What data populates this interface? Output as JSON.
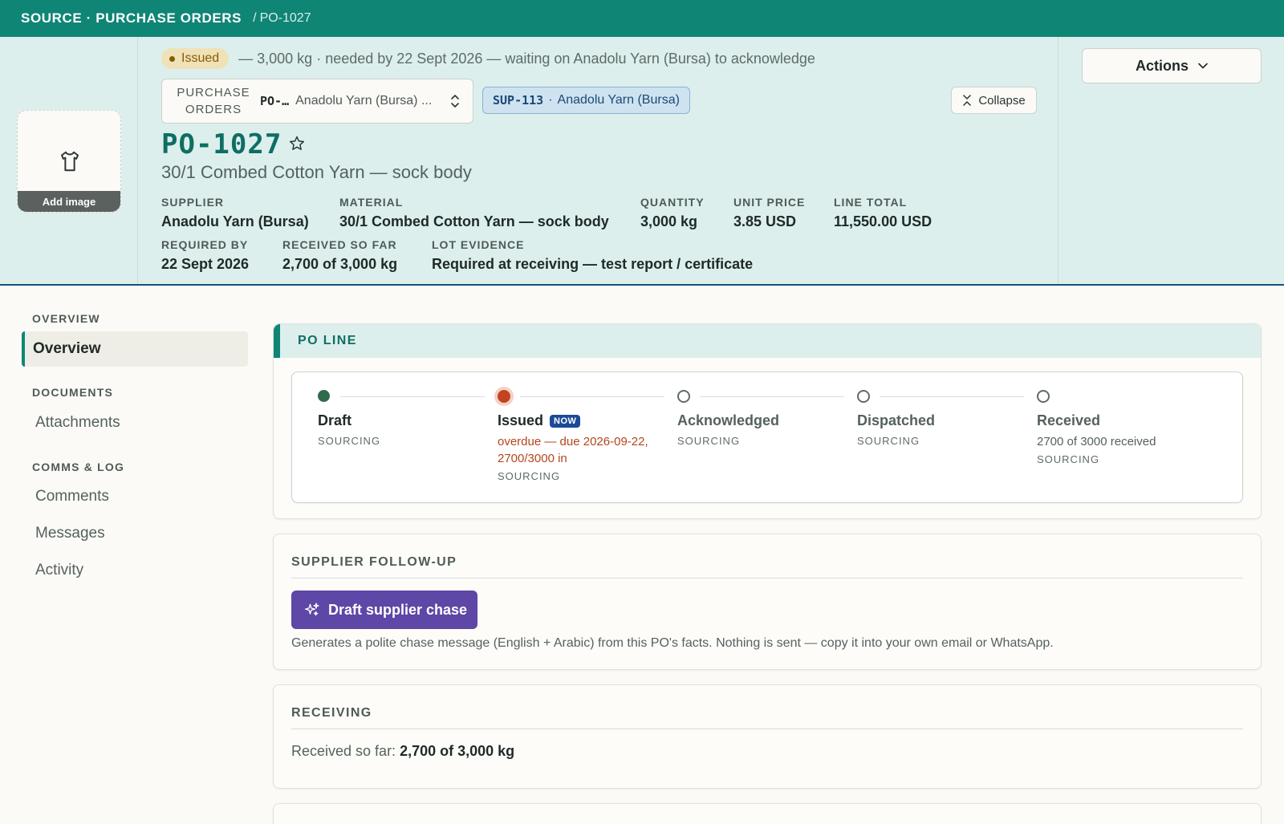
{
  "breadcrumb": {
    "root": "SOURCE · PURCHASE ORDERS",
    "separator": "/",
    "leaf": "PO-1027"
  },
  "header": {
    "status": "Issued",
    "summary": "— 3,000 kg · needed by 22 Sept 2026 — waiting on Anadolu Yarn (Bursa) to acknowledge",
    "record_select": {
      "label": "PURCHASE ORDERS",
      "code": "PO-…",
      "name": "Anadolu Yarn (Bursa) ..."
    },
    "supplier_chip": {
      "code": "SUP-113",
      "separator": "·",
      "name": "Anadolu Yarn (Bursa)"
    },
    "collapse_label": "Collapse",
    "actions_label": "Actions",
    "image_label": "Add image",
    "title": "PO-1027",
    "subtitle": "30/1 Combed Cotton Yarn — sock body",
    "fields": {
      "supplier": {
        "label": "SUPPLIER",
        "value": "Anadolu Yarn (Bursa)"
      },
      "material": {
        "label": "MATERIAL",
        "value": "30/1 Combed Cotton Yarn — sock body"
      },
      "quantity": {
        "label": "QUANTITY",
        "value": "3,000 kg"
      },
      "unit_price": {
        "label": "UNIT PRICE",
        "value": "3.85 USD"
      },
      "line_total": {
        "label": "LINE TOTAL",
        "value": "11,550.00 USD"
      },
      "required_by": {
        "label": "REQUIRED BY",
        "value": "22 Sept 2026"
      },
      "received": {
        "label": "RECEIVED SO FAR",
        "value": "2,700 of 3,000 kg"
      },
      "lot_evidence": {
        "label": "LOT EVIDENCE",
        "value": "Required at receiving — test report / certificate"
      }
    }
  },
  "nav": {
    "overview_section": "OVERVIEW",
    "overview_item": "Overview",
    "documents_section": "DOCUMENTS",
    "attachments_item": "Attachments",
    "comms_section": "COMMS & LOG",
    "comments_item": "Comments",
    "messages_item": "Messages",
    "activity_item": "Activity"
  },
  "po_line": {
    "title": "PO LINE",
    "steps": [
      {
        "title": "Draft",
        "detail_1": "",
        "detail_2": "",
        "role": "SOURCING",
        "state": "done"
      },
      {
        "title": "Issued",
        "badge": "NOW",
        "detail_1": "overdue — due 2026-09-22,",
        "detail_2": "2700/3000 in",
        "role": "SOURCING",
        "state": "current"
      },
      {
        "title": "Acknowledged",
        "detail_1": "",
        "detail_2": "",
        "role": "SOURCING",
        "state": "pending"
      },
      {
        "title": "Dispatched",
        "detail_1": "",
        "detail_2": "",
        "role": "SOURCING",
        "state": "pending"
      },
      {
        "title": "Received",
        "detail_1": "2700 of 3000 received",
        "detail_2": "",
        "role": "SOURCING",
        "state": "pending"
      }
    ]
  },
  "followup": {
    "title": "SUPPLIER FOLLOW-UP",
    "button_label": "Draft supplier chase",
    "help_text": "Generates a polite chase message (English + Arabic) from this PO's facts. Nothing is sent — copy it into your own email or WhatsApp."
  },
  "receiving": {
    "title": "RECEIVING",
    "label": "Received so far:",
    "value": "2,700 of 3,000 kg"
  },
  "colors": {
    "brand": "#0f8576",
    "status_done": "#2f6b4a",
    "status_current": "#c4431f",
    "chase_button": "#5e47a6"
  },
  "icons": {
    "image_placeholder": "tshirt-icon",
    "favorite": "star-icon",
    "select": "chevron-up-down-icon",
    "collapse": "collapse-icon",
    "actions": "chevron-down-icon",
    "chase": "sparkles-icon"
  }
}
